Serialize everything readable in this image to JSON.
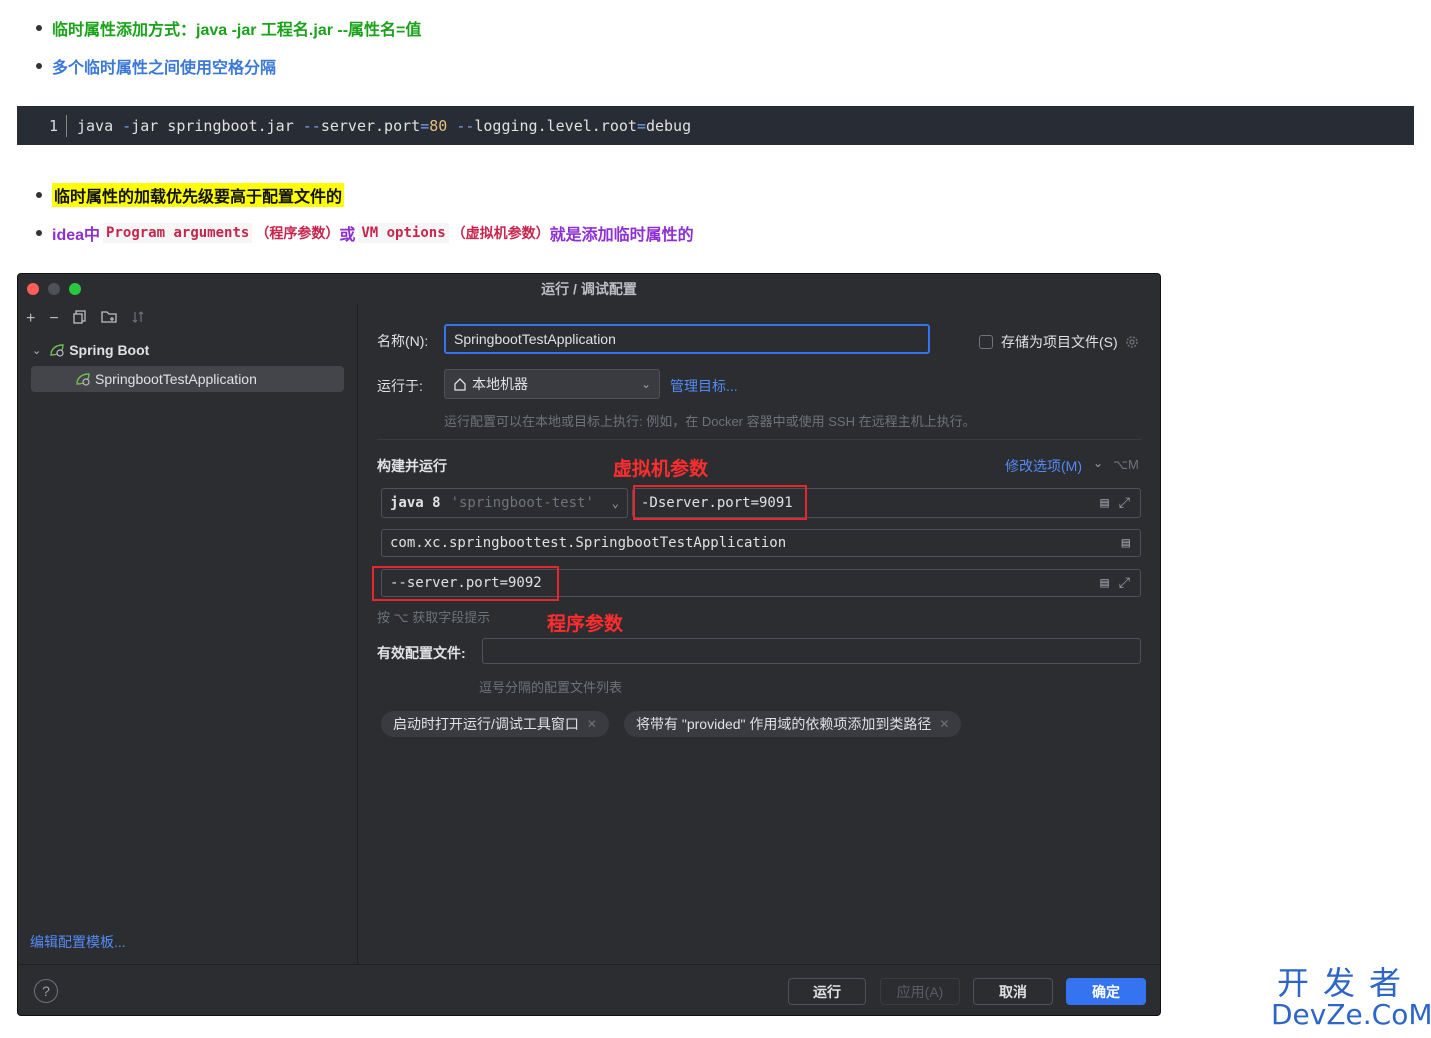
{
  "bullets": {
    "b1": "临时属性添加方式：java -jar 工程名.jar --属性名=值",
    "b2": "多个临时属性之间使用空格分隔",
    "b3": "临时属性的加载优先级要高于配置文件的",
    "b4": {
      "prefix": "idea中",
      "code1": "Program arguments",
      "paren1": "（程序参数）",
      "or": "或",
      "code2": "VM options",
      "paren2": "（虚拟机参数）",
      "suffix": "就是添加临时属性的"
    }
  },
  "codeblock": {
    "line_number": "1",
    "cmd": "java ",
    "dash1": "-",
    "jar": "jar springboot.jar ",
    "dash2": "--",
    "key1": "server.port",
    "eq1": "=",
    "val1": "80",
    "space": " ",
    "dash3": "--",
    "key2": "logging.level.root",
    "eq2": "=",
    "val2": "debug"
  },
  "window": {
    "title": "运行 / 调试配置",
    "tree_root": "Spring Boot",
    "tree_child": "SpringbootTestApplication",
    "edit_templates": "编辑配置模板...",
    "name_label": "名称(N):",
    "name_value": "SpringbootTestApplication",
    "store_label": "存储为项目文件(S)",
    "run_on_label": "运行于:",
    "run_on_value": "本地机器",
    "manage_targets": "管理目标...",
    "run_on_hint": "运行配置可以在本地或目标上执行: 例如，在 Docker 容器中或使用 SSH 在远程主机上执行。",
    "build_run_label": "构建并运行",
    "modify_options": "修改选项(M)",
    "modify_shortcut": "⌥M",
    "jdk_bold": "java 8",
    "jdk_module": "'springboot-test'",
    "vm_options_value": "-Dserver.port=9091",
    "main_class_value": "com.xc.springboottest.SpringbootTestApplication",
    "program_args_value": "--server.port=9092",
    "field_hint": "按 ⌥ 获取字段提示",
    "active_profiles_label": "有效配置文件:",
    "active_profiles_value": "",
    "active_profiles_hint": "逗号分隔的配置文件列表",
    "chip1": "启动时打开运行/调试工具窗口",
    "chip2": "将带有 \"provided\" 作用域的依赖项添加到类路径",
    "annot_vm": "虚拟机参数",
    "annot_prog": "程序参数",
    "btn_run": "运行",
    "btn_apply": "应用(A)",
    "btn_cancel": "取消",
    "btn_ok": "确定",
    "help": "?"
  },
  "watermark": {
    "cn": "开发者",
    "en": "DevZe.CoM"
  },
  "colors": {
    "accent": "#3574f0",
    "annotation_red": "#e8262b",
    "bg_dark": "#2b2d30"
  }
}
